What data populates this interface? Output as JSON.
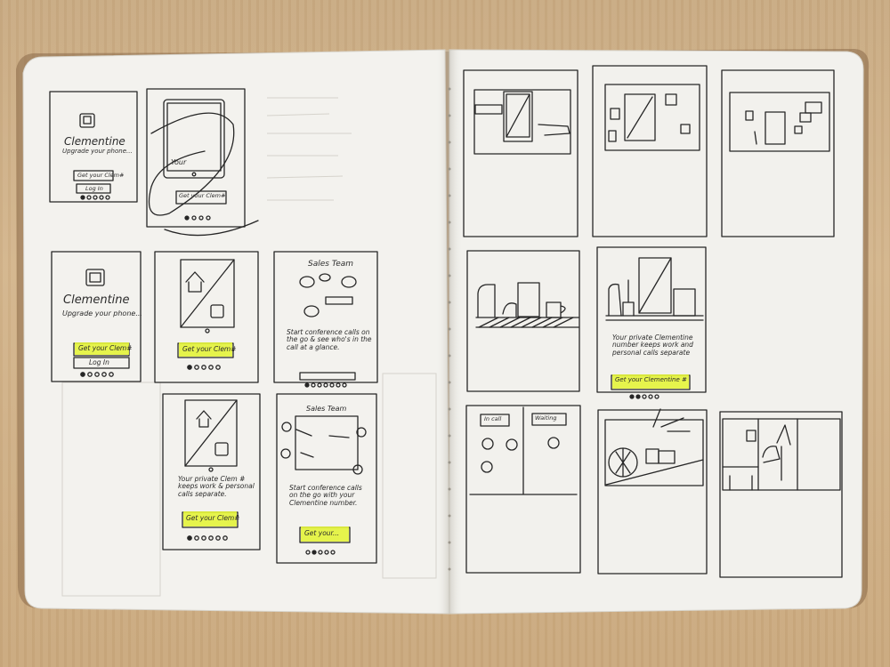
{
  "left_page": {
    "frame1": {
      "title": "Clementine",
      "subtitle": "Upgrade your phone...",
      "cta": "Get your Clem#",
      "login": "Log In"
    },
    "frame2": {
      "cta": "Get your Clem#",
      "scribble": "Your"
    },
    "frame3": {
      "title": "Clementine",
      "subtitle": "Upgrade your phone...",
      "cta": "Get your Clem#",
      "login": "Log In"
    },
    "frame4": {
      "cta": "Get your Clem#"
    },
    "frame5": {
      "header": "Sales Team",
      "body": "Start conference calls on the go & see who's in the call at a glance."
    },
    "frame6": {
      "body": "Your private Clem # keeps work & personal calls separate.",
      "cta": "Get your Clem#"
    },
    "frame7": {
      "header": "Sales Team",
      "body": "Start conference calls on the go with your Clementine number.",
      "cta": "Get your..."
    }
  },
  "right_page": {
    "frame12": {
      "body": "Your private Clementine number keeps work and personal calls separate",
      "cta": "Get your Clementine #"
    },
    "frame13": {
      "label_left": "In call",
      "label_right": "Waiting"
    }
  },
  "colors": {
    "highlighter": "#e4f43a",
    "ink": "#262626",
    "paper": "#f3f2ee",
    "table": "#c9ab83"
  }
}
